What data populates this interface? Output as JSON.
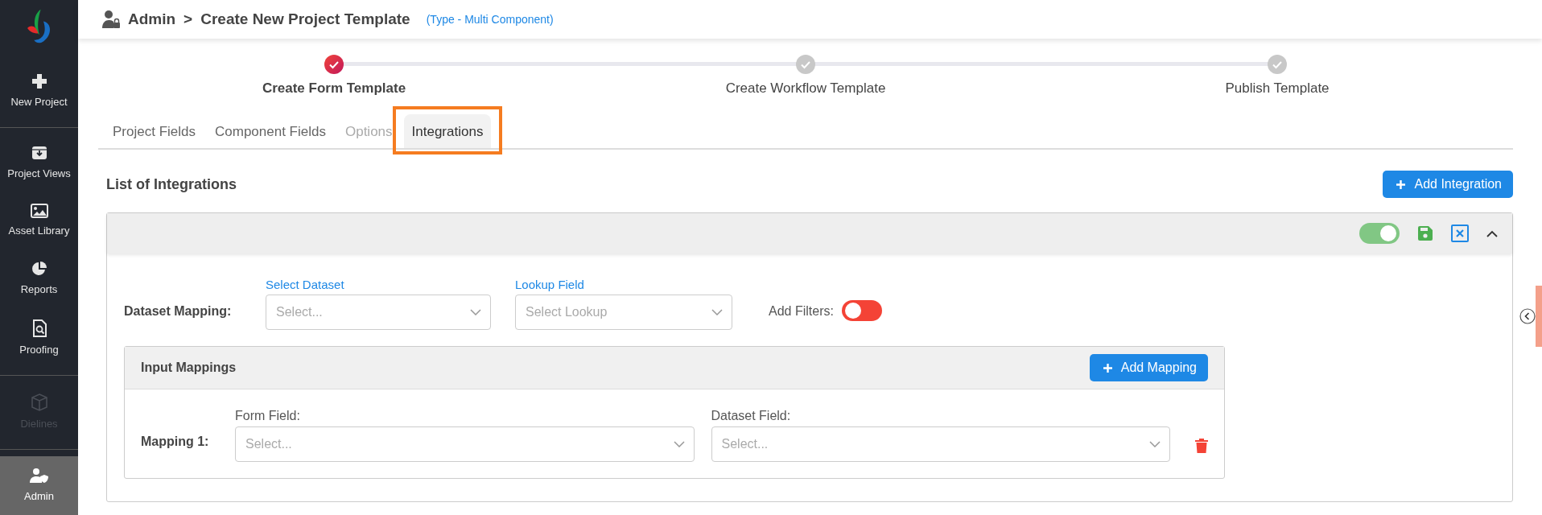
{
  "sidebar": {
    "items": [
      {
        "label": "New Project",
        "selected": false,
        "disabled": false
      },
      {
        "label": "Project Views",
        "selected": false,
        "disabled": false
      },
      {
        "label": "Asset Library",
        "selected": false,
        "disabled": false
      },
      {
        "label": "Reports",
        "selected": false,
        "disabled": false
      },
      {
        "label": "Proofing",
        "selected": false,
        "disabled": false
      },
      {
        "label": "Dielines",
        "selected": false,
        "disabled": true
      },
      {
        "label": "Admin",
        "selected": true,
        "disabled": false
      }
    ]
  },
  "header": {
    "breadcrumb": "Admin",
    "separator": ">",
    "title": "Create New Project Template",
    "type_note": "(Type - Multi Component)"
  },
  "stepper": {
    "steps": [
      {
        "label": "Create Form Template",
        "selected": true
      },
      {
        "label": "Create Workflow Template",
        "selected": false
      },
      {
        "label": "Publish Template",
        "selected": false
      }
    ]
  },
  "tabs": [
    {
      "label": "Project Fields",
      "selected": false,
      "disabled": false
    },
    {
      "label": "Component Fields",
      "selected": false,
      "disabled": false
    },
    {
      "label": "Options",
      "selected": false,
      "disabled": true
    },
    {
      "label": "Integrations",
      "selected": true,
      "disabled": false
    }
  ],
  "section": {
    "title": "List of Integrations",
    "add_button": "Add Integration"
  },
  "integration": {
    "enabled": true,
    "dataset_mapping": {
      "label": "Dataset Mapping:",
      "select_dataset": {
        "label": "Select Dataset",
        "placeholder": "Select..."
      },
      "lookup_field": {
        "label": "Lookup Field",
        "placeholder": "Select Lookup"
      },
      "add_filters": {
        "label": "Add Filters:",
        "on": false
      }
    },
    "input_mappings": {
      "title": "Input Mappings",
      "add_button": "Add Mapping",
      "mappings": [
        {
          "label": "Mapping 1:",
          "form_field": {
            "label": "Form Field:",
            "placeholder": "Select..."
          },
          "dataset_field": {
            "label": "Dataset Field:",
            "placeholder": "Select..."
          }
        }
      ]
    }
  }
}
